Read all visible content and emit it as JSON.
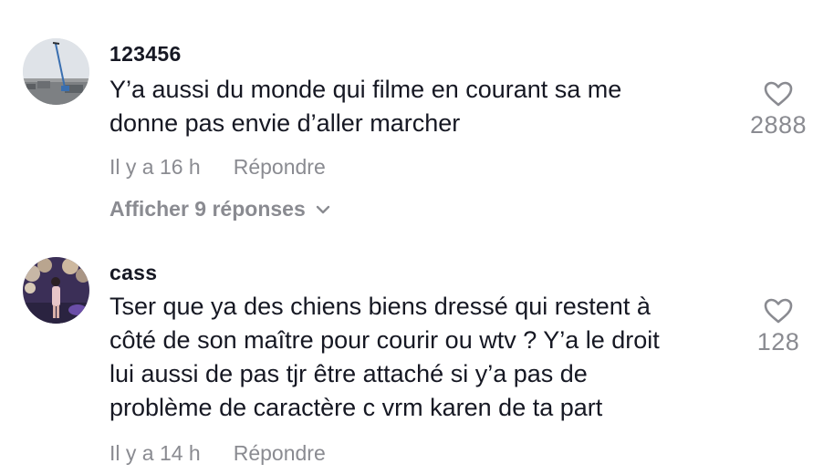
{
  "comments": [
    {
      "username": "123456",
      "text_lines": [
        "Y’a aussi du monde qui filme en courant sa me",
        "donne pas envie d’aller marcher"
      ],
      "timestamp": "Il y a 16 h",
      "reply_label": "Répondre",
      "likes": "2888",
      "view_replies": "Afficher 9 réponses",
      "avatar_icon": "crane-photo"
    },
    {
      "username": "cass",
      "text_lines": [
        "Tser que ya des chiens biens dressé qui restent à",
        "côté de son maître pour courir ou wtv ? Y’a le droit",
        "lui aussi de pas tjr être attaché si y’a pas de",
        "problème de caractère c vrm karen de ta part"
      ],
      "timestamp": "Il y a 14 h",
      "reply_label": "Répondre",
      "likes": "128",
      "avatar_icon": "person-photo"
    }
  ],
  "colors": {
    "text": "#161823",
    "muted": "#8a8b91",
    "background": "#ffffff"
  },
  "icons": {
    "like": "heart-outline-icon",
    "expand": "chevron-down-icon"
  }
}
